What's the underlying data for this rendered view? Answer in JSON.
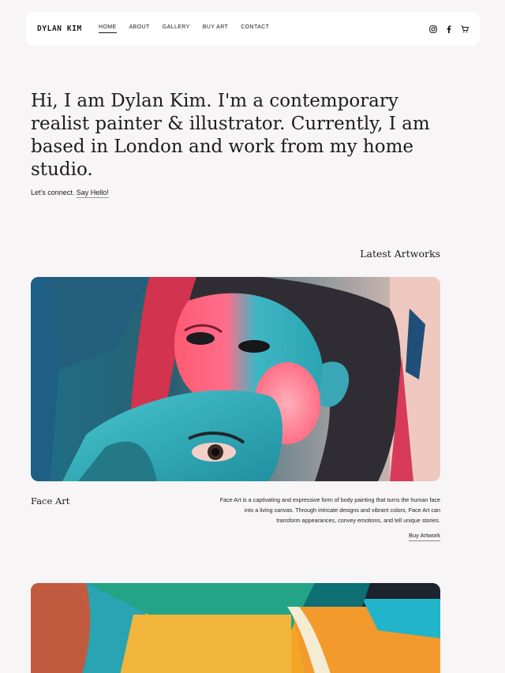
{
  "nav": {
    "brand": "DYLAN KIM",
    "items": [
      {
        "label": "HOME",
        "active": true
      },
      {
        "label": "ABOUT",
        "active": false
      },
      {
        "label": "GALLERY",
        "active": false
      },
      {
        "label": "BUY ART",
        "active": false
      },
      {
        "label": "CONTACT",
        "active": false
      }
    ],
    "socials": [
      "instagram-icon",
      "facebook-icon",
      "cart-icon"
    ]
  },
  "hero": {
    "headline": "Hi, I am Dylan Kim. I'm a contemporary realist painter & illustrator. Currently, I am based in London and work from my home studio.",
    "connect_text": "Let's connect.",
    "connect_link": "Say Hello!"
  },
  "latest": {
    "title": "Latest Artworks",
    "artworks": [
      {
        "title": "Face Art",
        "description": "Face Art is a captivating and expressive form of body painting that turns the human face into a living canvas. Through intricate designs and vibrant colors, Face Art can transform appearances, convey emotions, and tell unique stories.",
        "link": "Buy Artwork"
      }
    ]
  },
  "colors": {
    "background": "#f8f5f7",
    "nav_bg": "#ffffff",
    "text": "#1a1a1a"
  }
}
